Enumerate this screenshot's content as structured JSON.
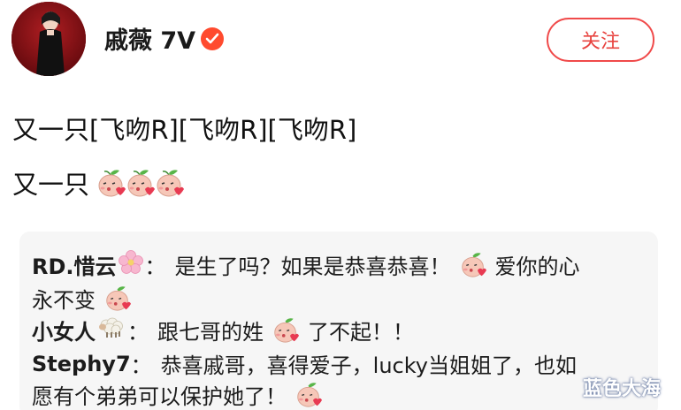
{
  "header": {
    "username": "戚薇 7V",
    "follow_label": "关注"
  },
  "post": {
    "line1": "又一只[飞吻R][飞吻R][飞吻R]",
    "line2": "又一只",
    "line2_emoji_count": 3
  },
  "comments": [
    {
      "name": "RD.惜云",
      "text_a": "是生了吗？如果是恭喜恭喜！",
      "text_b": "爱你的心",
      "text_c": "永不变"
    },
    {
      "name": "小女人",
      "text_a": "跟七哥的姓",
      "text_b": "了不起！！"
    },
    {
      "name": "Stephy7",
      "text_a": "恭喜戚哥，喜得爱子，lucky当姐姐了，也如",
      "text_b": "愿有个弟弟可以保护她了！"
    }
  ],
  "watermark": "蓝色大海",
  "colors": {
    "accent": "#e8433f",
    "verified": "#ff4a2e",
    "comment_bg": "#f6f6f6"
  }
}
